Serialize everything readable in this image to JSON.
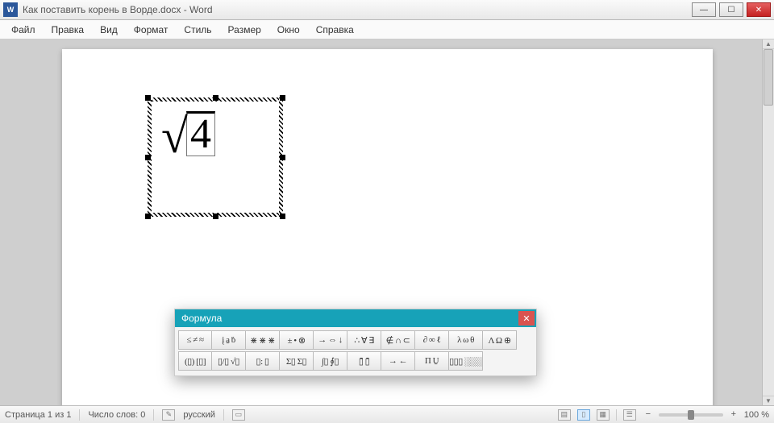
{
  "titlebar": {
    "app_icon_text": "W",
    "title": "Как поставить корень в Ворде.docx - Word"
  },
  "menu": {
    "items": [
      "Файл",
      "Правка",
      "Вид",
      "Формат",
      "Стиль",
      "Размер",
      "Окно",
      "Справка"
    ]
  },
  "equation": {
    "radical": "√",
    "radicand": "4"
  },
  "formula_win": {
    "title": "Формула",
    "row1": [
      "≤ ≠ ≈",
      "į a̱ ḃ",
      "⋇ ⋇ ⋇",
      "± • ⊗",
      "→ ⇔ ↓",
      "∴ ∀ ∃",
      "∉ ∩ ⊂",
      "∂ ∞ ℓ",
      "λ ω θ",
      "Λ Ω ⊕"
    ],
    "row2": [
      "(▯) [▯]",
      "▯/▯  √▯",
      "▯: ▯",
      "Σ▯ Σ▯",
      "∫▯ ∮▯",
      "▯̄ ▯̄",
      "→  ←",
      "Π  U̱",
      "▯▯▯ ░░░"
    ]
  },
  "statusbar": {
    "page": "Страница 1 из 1",
    "wordcount": "Число слов: 0",
    "lang": "русский",
    "zoom": "100 %"
  }
}
